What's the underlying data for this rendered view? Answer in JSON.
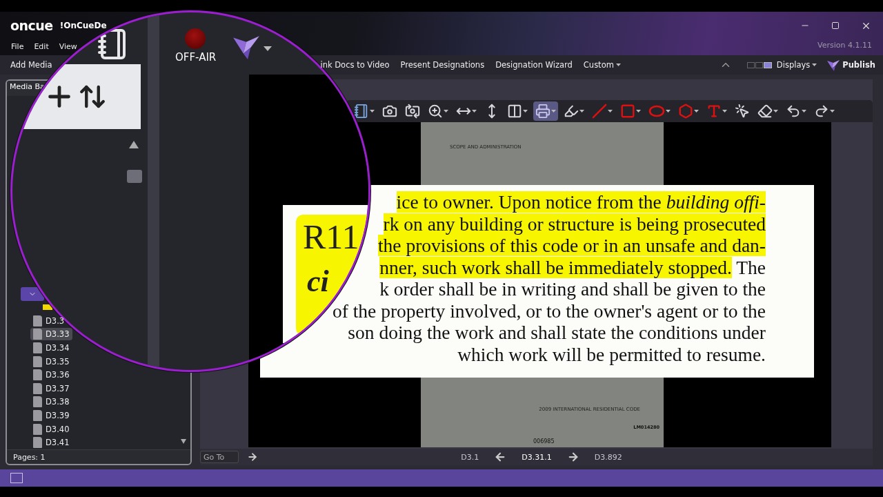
{
  "app": {
    "logo": "oncue",
    "title": "!OnCueDe",
    "version": "Version 4.1.11"
  },
  "menu": [
    "File",
    "Edit",
    "View"
  ],
  "ribbon": {
    "add_media": "Add Media",
    "items": [
      {
        "label": "ink Docs to Video",
        "dropdown": false
      },
      {
        "label": "Present Designations",
        "dropdown": false
      },
      {
        "label": "Designation Wizard",
        "dropdown": false
      },
      {
        "label": "Custom",
        "dropdown": true
      }
    ],
    "displays": "Displays",
    "publish": "Publish"
  },
  "on_air": {
    "label": "OFF-AIR",
    "live": false
  },
  "media_panel": {
    "tab": "Media Ba",
    "tree": [
      {
        "kind": "folder",
        "expanded": true,
        "children": [
          {
            "kind": "annotation",
            "selected": false
          },
          {
            "kind": "pdf",
            "label": "D3.3",
            "selected": false
          },
          {
            "kind": "pdf",
            "label": "D3.33",
            "selected": true
          },
          {
            "kind": "pdf",
            "label": "D3.34",
            "selected": false
          },
          {
            "kind": "pdf",
            "label": "D3.35",
            "selected": false
          },
          {
            "kind": "pdf",
            "label": "D3.36",
            "selected": false
          },
          {
            "kind": "pdf",
            "label": "D3.37",
            "selected": false
          },
          {
            "kind": "pdf",
            "label": "D3.38",
            "selected": false
          },
          {
            "kind": "pdf",
            "label": "D3.39",
            "selected": false
          },
          {
            "kind": "pdf",
            "label": "D3.40",
            "selected": false
          },
          {
            "kind": "pdf",
            "label": "D3.41",
            "selected": false
          }
        ]
      }
    ],
    "pages": "Pages: 1"
  },
  "viewer": {
    "tools": [
      {
        "kind": "notebook",
        "menu": true,
        "selected": false
      },
      {
        "kind": "camera-add",
        "menu": false,
        "selected": false
      },
      {
        "kind": "camera-share",
        "menu": false,
        "selected": false
      },
      {
        "kind": "zoom",
        "menu": true,
        "selected": false
      },
      {
        "kind": "fit-width",
        "menu": true,
        "selected": false
      },
      {
        "kind": "fit-height",
        "menu": false,
        "selected": false
      },
      {
        "kind": "two-page",
        "menu": true,
        "selected": false
      },
      {
        "kind": "callout",
        "menu": true,
        "selected": true
      },
      {
        "kind": "highlighter",
        "menu": true,
        "selected": false
      },
      {
        "kind": "line",
        "menu": true,
        "selected": false
      },
      {
        "kind": "rectangle",
        "menu": true,
        "selected": false
      },
      {
        "kind": "ellipse",
        "menu": true,
        "selected": false
      },
      {
        "kind": "polygon",
        "menu": true,
        "selected": false
      },
      {
        "kind": "text",
        "menu": true,
        "selected": false
      },
      {
        "kind": "pointer",
        "menu": false,
        "selected": false
      },
      {
        "kind": "eraser",
        "menu": true,
        "selected": false
      },
      {
        "kind": "undo",
        "menu": true,
        "selected": false
      },
      {
        "kind": "redo",
        "menu": true,
        "selected": false
      }
    ],
    "page": {
      "header": "SCOPE AND ADMINISTRATION",
      "footer": "2009 INTERNATIONAL RESIDENTIAL CODE",
      "stamp": "LM014280",
      "number": "006985"
    },
    "callout": {
      "heading": "R11",
      "subheading": "ci",
      "lines": [
        [
          {
            "text": "ice to owner. Upon notice from the *building offi-*",
            "highlighted": true
          }
        ],
        [
          {
            "text": "rk on any building or structure is being prosecuted",
            "highlighted": true
          }
        ],
        [
          {
            "text": "the provisions of this code or in an unsafe and dan-",
            "highlighted": true
          }
        ],
        [
          {
            "text": "nner, such work shall be immediately stopped.",
            "highlighted": true
          },
          {
            "text": " The",
            "highlighted": false
          }
        ],
        [
          {
            "text": "k order shall be in writing and shall be given to the",
            "highlighted": false
          }
        ],
        [
          {
            "text": "of the property involved, or to the owner's agent or to the",
            "highlighted": false
          }
        ],
        [
          {
            "text": "son doing the work and shall state the conditions under",
            "highlighted": false
          }
        ],
        [
          {
            "text": "which work will be permitted to resume.",
            "highlighted": false
          }
        ]
      ]
    },
    "nav": {
      "goto_placeholder": "Go To",
      "first": "D3.1",
      "current": "D3.31.1",
      "last": "D3.892"
    }
  }
}
